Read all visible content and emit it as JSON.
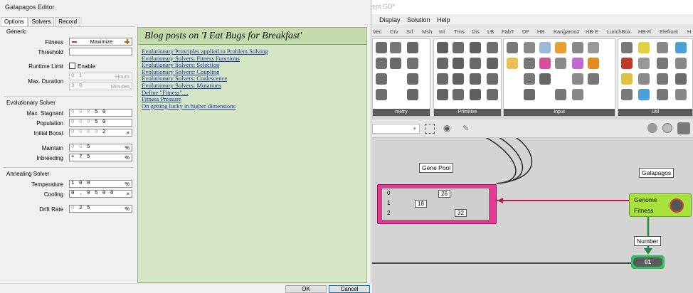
{
  "dialog": {
    "title": "Galapagos Editor",
    "tabs": [
      {
        "label": "Options"
      },
      {
        "label": "Solvers"
      },
      {
        "label": "Record"
      }
    ],
    "generic": {
      "header": "Generic",
      "fitness_label": "Fitness",
      "fitness_value": "Maximize",
      "threshold_label": "Threshold",
      "runtime_label": "Runtime Limit",
      "runtime_enable": "Enable",
      "maxdur_label": "Max. Duration",
      "hours_value": "1",
      "hours_unit": "Hours",
      "minutes_value": "3 0",
      "minutes_unit": "Minutes"
    },
    "evo": {
      "header": "Evolutionary Solver",
      "stagnant_label": "Max. Stagnant",
      "stagnant_value": "5 0",
      "stagnant_prefix": "0 0 0",
      "population_label": "Population",
      "population_value": "5 0",
      "population_prefix": "0 0 0",
      "boost_label": "Initial Boost",
      "boost_value": "2",
      "boost_prefix": "0 0 0 0",
      "boost_unit": "×",
      "maintain_label": "Maintain",
      "maintain_value": "5",
      "maintain_prefix": "0 0",
      "maintain_unit": "%",
      "inbreeding_label": "Inbreeding",
      "inbreeding_value": "7 5",
      "inbreeding_prefix": "+",
      "inbreeding_unit": "%"
    },
    "anneal": {
      "header": "Annealing Solver",
      "temperature_label": "Temperature",
      "temperature_value": "1 0 0",
      "temperature_unit": "%",
      "cooling_label": "Cooling",
      "cooling_value": "0 . 9 5 0 0",
      "cooling_unit": "×",
      "drift_label": "Drift Rate",
      "drift_value": "2 5",
      "drift_prefix": "0",
      "drift_unit": "%"
    },
    "blog": {
      "title": "Blog posts on 'I Eat Bugs for Breakfast'",
      "links": [
        "Evolutionary Principles applied to Problem Solving",
        "Evolutionary Solvers: Fitness Functions",
        "Evolutionary Solvers: Selection",
        "Evolutionary Solvers: Coupling",
        "Evolutionary Solvers: Coalescence",
        "Evolutionary Solvers: Mutations",
        "Define \"Fitness\"....",
        "Fitness Pressure",
        "On getting lucky in higher dimensions"
      ]
    },
    "ok_label": "OK",
    "cancel_label": "Cancel"
  },
  "grasshopper": {
    "title_fragment": "ept GD*",
    "menu": [
      "Display",
      "Solution",
      "Help"
    ],
    "category_tabs": [
      "Vec",
      "Crv",
      "Srf",
      "Msh",
      "Int",
      "Trns",
      "Dis",
      "LB",
      "FabT",
      "DF",
      "HB",
      "Kangaroo2",
      "HB-E",
      "LunchBox",
      "HB-R",
      "Elefront",
      "H"
    ],
    "ribbon_groups": [
      "metry",
      "Primitive",
      "Input",
      "Util"
    ],
    "gene_pool": {
      "label": "Gene Pool",
      "rows": [
        "0",
        "1",
        "2"
      ],
      "values": [
        "26",
        "18",
        "32"
      ]
    },
    "galapagos": {
      "label": "Galapagos",
      "genome": "Genome",
      "fitness": "Fitness"
    },
    "number": {
      "label": "Number",
      "value": "01"
    }
  }
}
